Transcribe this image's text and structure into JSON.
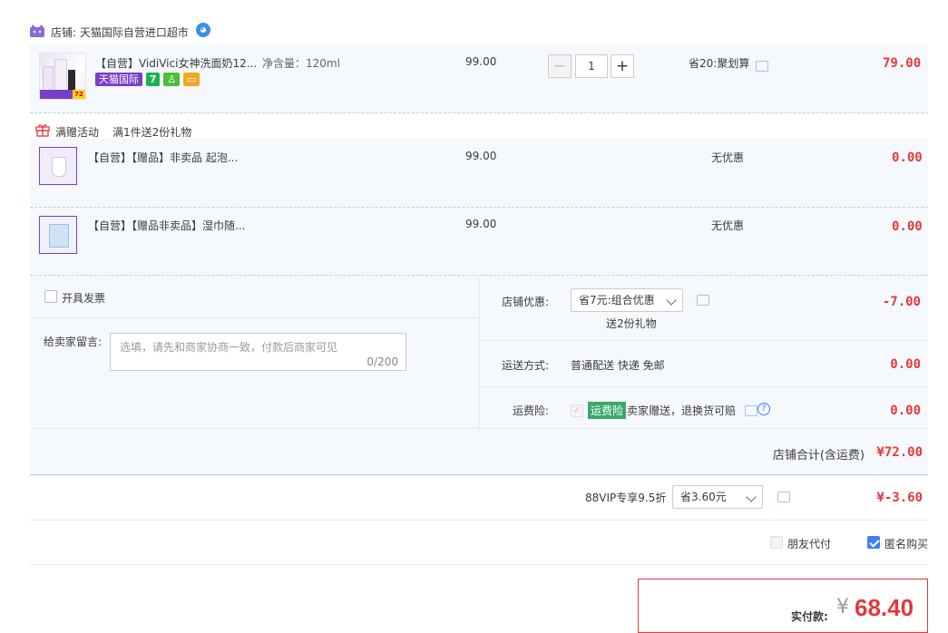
{
  "shop": {
    "label": "店铺: 天猫国际自营进口超市"
  },
  "items": [
    {
      "title": "【自营】VidiVici女神洗面奶12...",
      "spec": "净含量：120ml",
      "price": "99.00",
      "quantity": "1",
      "promo": "省20:聚划算",
      "total": "79.00",
      "tag_tmall": "天猫国际",
      "tag_seven": "7",
      "thumb_badge": "72"
    }
  ],
  "gift": {
    "label": "满赠活动",
    "desc": "满1件送2份礼物",
    "items": [
      {
        "title": "【自营】【赠品】非卖品 起泡...",
        "price": "99.00",
        "promo": "无优惠",
        "total": "0.00"
      },
      {
        "title": "【自营】【赠品非卖品】湿巾随...",
        "price": "99.00",
        "promo": "无优惠",
        "total": "0.00"
      }
    ]
  },
  "order_opts": {
    "invoice_label": "开具发票",
    "message_label": "给卖家留言:",
    "message_placeholder": "选填，请先和商家协商一致，付款后商家可见",
    "message_count": "0/200",
    "shop_discount_label": "店铺优惠:",
    "shop_discount_value": "省7元:组合优惠",
    "shop_discount_note": "送2份礼物",
    "shop_discount_amount": "-7.00",
    "shipping_label": "运送方式:",
    "shipping_value": "普通配送 快递 免邮",
    "shipping_amount": "0.00",
    "insurance_label": "运费险:",
    "insurance_tag": "运费险",
    "insurance_text": "卖家赠送，退换货可赔",
    "insurance_amount": "0.00",
    "shop_total_label": "店铺合计(含运费)",
    "shop_total_value": "¥72.00"
  },
  "vip": {
    "label": "88VIP专享9.5折",
    "select_value": "省3.60元",
    "amount": "¥-3.60"
  },
  "pay_options": {
    "friend_pay": "朋友代付",
    "anonymous": "匿名购买"
  },
  "payment": {
    "label": "实付款:",
    "currency": "¥",
    "amount": "68.40"
  },
  "colors": {
    "accent_red": "#e4393c",
    "blue": "#3e7ef7",
    "tmall_purple": "#7a3fc8"
  }
}
